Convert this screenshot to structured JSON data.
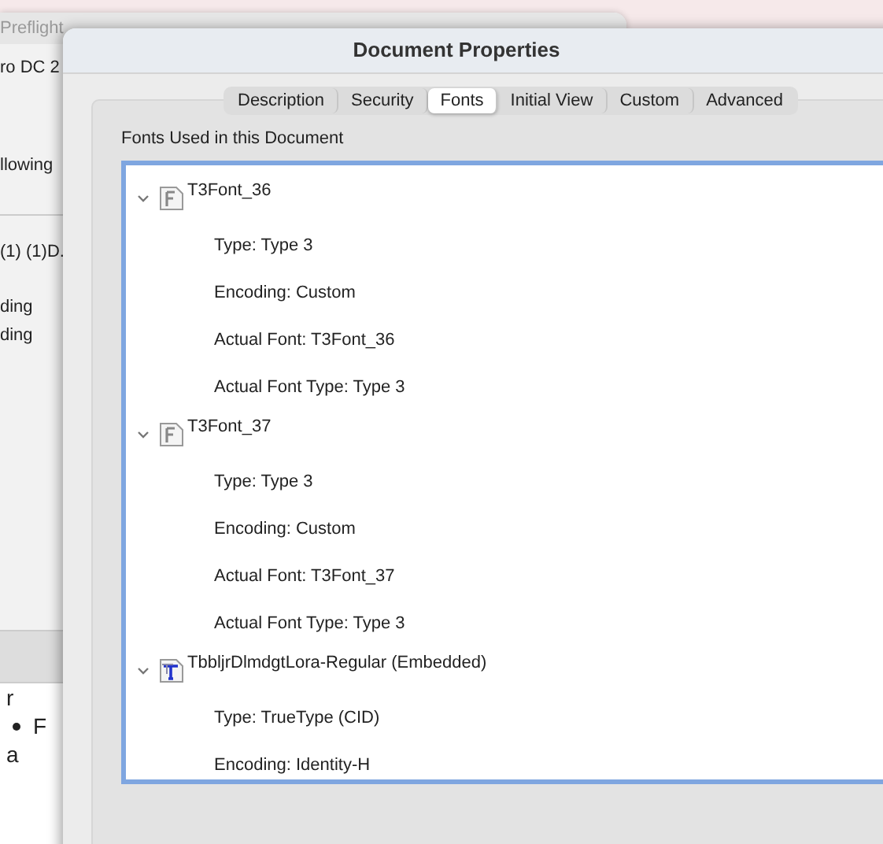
{
  "background_window": {
    "title": "Preflight",
    "lines": [
      "ro DC 2",
      "llowing",
      "(1) (1)D.",
      "ding",
      "ding"
    ],
    "body_lines": [
      "r",
      "F",
      "a"
    ]
  },
  "window": {
    "title": "Document Properties"
  },
  "tabs": [
    {
      "label": "Description",
      "selected": false
    },
    {
      "label": "Security",
      "selected": false
    },
    {
      "label": "Fonts",
      "selected": true
    },
    {
      "label": "Initial View",
      "selected": false
    },
    {
      "label": "Custom",
      "selected": false
    },
    {
      "label": "Advanced",
      "selected": false
    }
  ],
  "fonts_group": {
    "label": "Fonts Used in this Document",
    "fonts": [
      {
        "name": "T3Font_36",
        "kind": "type3",
        "expanded": true,
        "children": [
          {
            "label": "Type: Type 3"
          },
          {
            "label": "Encoding: Custom"
          },
          {
            "label": "Actual Font: T3Font_36"
          },
          {
            "label": "Actual Font Type: Type 3"
          }
        ]
      },
      {
        "name": "T3Font_37",
        "kind": "type3",
        "expanded": true,
        "children": [
          {
            "label": "Type: Type 3"
          },
          {
            "label": "Encoding: Custom"
          },
          {
            "label": "Actual Font: T3Font_37"
          },
          {
            "label": "Actual Font Type: Type 3"
          }
        ]
      },
      {
        "name": "TbbljrDlmdgtLora-Regular (Embedded)",
        "kind": "truetype",
        "expanded": true,
        "children": [
          {
            "label": "Type: TrueType (CID)"
          },
          {
            "label": "Encoding: Identity-H"
          }
        ]
      }
    ]
  }
}
